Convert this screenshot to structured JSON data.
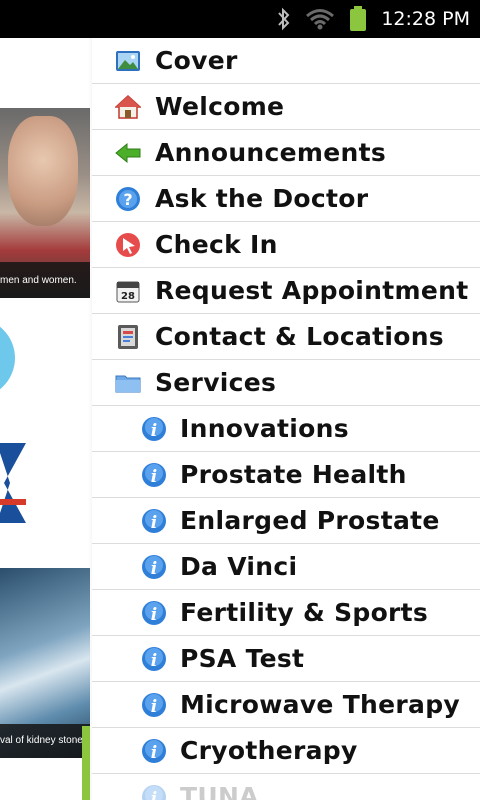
{
  "status_bar": {
    "time": "12:28 PM",
    "icons": [
      "bluetooth-icon",
      "wifi-icon",
      "battery-icon"
    ],
    "battery_color": "#8cc63f"
  },
  "background": {
    "caption_top": "men and women.",
    "caption_bottom": "val of kidney stones",
    "accent_blue": "#6ec8ec",
    "accent_green": "#8cc63f"
  },
  "menu": {
    "items": [
      {
        "label": "Cover",
        "icon": "picture-icon",
        "level": 0
      },
      {
        "label": "Welcome",
        "icon": "home-icon",
        "level": 0
      },
      {
        "label": "Announcements",
        "icon": "green-arrow-icon",
        "level": 0
      },
      {
        "label": "Ask the Doctor",
        "icon": "question-icon",
        "level": 0
      },
      {
        "label": "Check In",
        "icon": "cursor-badge-icon",
        "level": 0
      },
      {
        "label": "Request Appointment",
        "icon": "calendar-icon",
        "level": 0
      },
      {
        "label": "Contact & Locations",
        "icon": "contact-card-icon",
        "level": 0
      },
      {
        "label": "Services",
        "icon": "folder-icon",
        "level": 0
      },
      {
        "label": "Innovations",
        "icon": "info-icon",
        "level": 1
      },
      {
        "label": "Prostate Health",
        "icon": "info-icon",
        "level": 1
      },
      {
        "label": "Enlarged Prostate",
        "icon": "info-icon",
        "level": 1
      },
      {
        "label": "Da Vinci",
        "icon": "info-icon",
        "level": 1
      },
      {
        "label": "Fertility & Sports",
        "icon": "info-icon",
        "level": 1
      },
      {
        "label": "PSA Test",
        "icon": "info-icon",
        "level": 1
      },
      {
        "label": "Microwave Therapy",
        "icon": "info-icon",
        "level": 1
      },
      {
        "label": "Cryotherapy",
        "icon": "info-icon",
        "level": 1
      },
      {
        "label": "TUNA",
        "icon": "info-icon",
        "level": 1
      }
    ]
  }
}
